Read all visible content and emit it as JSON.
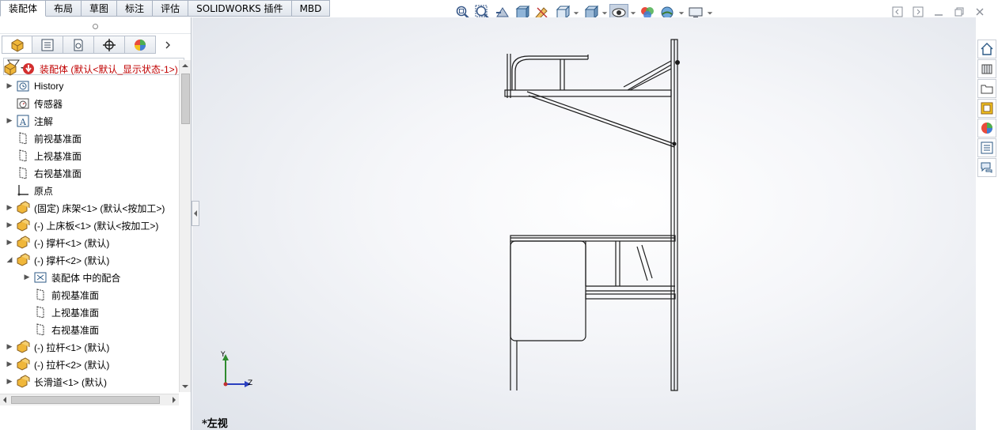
{
  "command_tabs": [
    "装配体",
    "布局",
    "草图",
    "标注",
    "评估",
    "SOLIDWORKS 插件",
    "MBD"
  ],
  "active_tab": "装配体",
  "view_toolbar": {
    "icons": [
      "zoom-to-fit-icon",
      "zoom-to-area-icon",
      "previous-view-icon",
      "section-view-icon",
      "dynamic-annotation-icon",
      "view-orientation-icon",
      "display-style-icon",
      "hide-show-items-icon",
      "edit-appearance-icon",
      "apply-scene-icon",
      "view-settings-icon"
    ]
  },
  "panel_tabs": [
    "feature-manager-icon",
    "property-manager-icon",
    "configuration-manager-icon",
    "dimxpert-manager-icon",
    "display-manager-icon"
  ],
  "tree": {
    "root": "装配体  (默认<默认_显示状态-1>)",
    "items": [
      {
        "label": "History",
        "icon": "history-icon",
        "expandable": true,
        "indent": 0
      },
      {
        "label": "传感器",
        "icon": "sensor-icon",
        "expandable": false,
        "indent": 0
      },
      {
        "label": "注解",
        "icon": "annotation-icon",
        "expandable": true,
        "indent": 0
      },
      {
        "label": "前视基准面",
        "icon": "plane-icon",
        "expandable": false,
        "indent": 0
      },
      {
        "label": "上视基准面",
        "icon": "plane-icon",
        "expandable": false,
        "indent": 0
      },
      {
        "label": "右视基准面",
        "icon": "plane-icon",
        "expandable": false,
        "indent": 0
      },
      {
        "label": "原点",
        "icon": "origin-icon",
        "expandable": false,
        "indent": 0
      },
      {
        "label": "(固定) 床架<1> (默认<按加工>)",
        "icon": "subassembly-icon",
        "expandable": true,
        "indent": 0
      },
      {
        "label": "(-) 上床板<1> (默认<按加工>)",
        "icon": "subassembly-icon",
        "expandable": true,
        "indent": 0
      },
      {
        "label": "(-) 撑杆<1> (默认)",
        "icon": "subassembly-icon",
        "expandable": true,
        "indent": 0
      },
      {
        "label": "(-) 撑杆<2> (默认)",
        "icon": "subassembly-icon",
        "expandable": true,
        "expanded": true,
        "indent": 0
      },
      {
        "label": "装配体 中的配合",
        "icon": "mates-icon",
        "expandable": true,
        "indent": 1
      },
      {
        "label": "前视基准面",
        "icon": "plane-icon",
        "expandable": false,
        "indent": 1
      },
      {
        "label": "上视基准面",
        "icon": "plane-icon",
        "expandable": false,
        "indent": 1
      },
      {
        "label": "右视基准面",
        "icon": "plane-icon",
        "expandable": false,
        "indent": 1
      },
      {
        "label": "(-) 拉杆<1> (默认)",
        "icon": "subassembly-icon",
        "expandable": true,
        "indent": 0
      },
      {
        "label": "(-) 拉杆<2> (默认)",
        "icon": "subassembly-icon",
        "expandable": true,
        "indent": 0
      },
      {
        "label": "长滑道<1> (默认)",
        "icon": "subassembly-icon",
        "expandable": true,
        "indent": 0
      }
    ]
  },
  "viewport": {
    "view_name": "*左视",
    "triad": {
      "y_label": "Y",
      "z_label": "Z"
    }
  },
  "right_taskpane": [
    "home-icon",
    "design-library-icon",
    "file-explorer-icon",
    "view-palette-icon",
    "appearances-icon",
    "custom-properties-icon",
    "forum-icon"
  ],
  "colors": {
    "error": "#d32f2f",
    "accent": "#2a6fc4"
  }
}
